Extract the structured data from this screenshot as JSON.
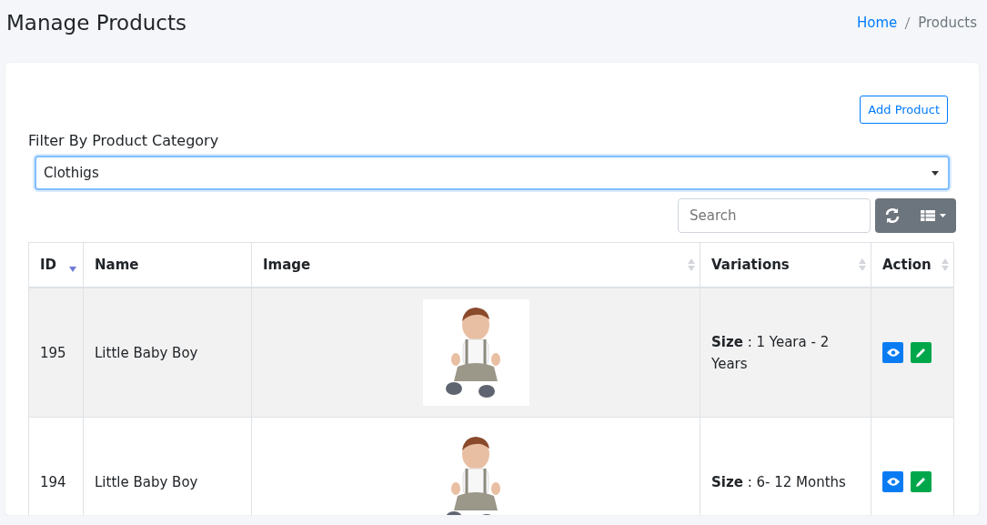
{
  "page_title": "Manage Products",
  "breadcrumb": [
    {
      "label": "Home",
      "kind": "link"
    },
    {
      "label": "Products",
      "kind": "current"
    }
  ],
  "add_button": "Add Product",
  "filter": {
    "label": "Filter By Product Category",
    "value": "Clothigs"
  },
  "search": {
    "placeholder": "Search"
  },
  "table": {
    "columns": [
      {
        "label": "ID",
        "sortable": true,
        "sorted": true
      },
      {
        "label": "Name",
        "sortable": false,
        "sorted": false
      },
      {
        "label": "Image",
        "sortable": true,
        "sorted": false
      },
      {
        "label": "Variations",
        "sortable": true,
        "sorted": false
      },
      {
        "label": "Action",
        "sortable": true,
        "sorted": false
      }
    ],
    "rows": [
      {
        "id": "195",
        "name": "Little Baby Boy",
        "variations": "**Size** : 1 Yeara - 2 Years",
        "highlighted": true
      },
      {
        "id": "194",
        "name": "Little Baby Boy",
        "variations": "**Size** : 6- 12 Months",
        "highlighted": false
      }
    ]
  }
}
